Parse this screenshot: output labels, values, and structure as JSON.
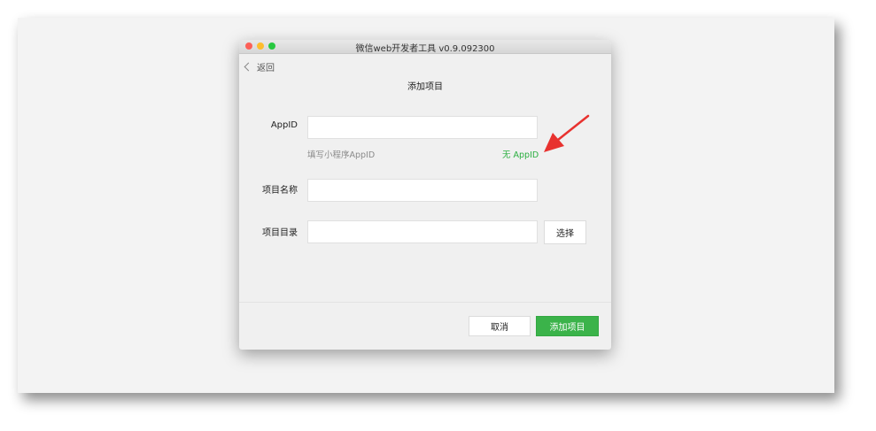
{
  "window": {
    "title": "微信web开发者工具 v0.9.092300"
  },
  "nav": {
    "back_label": "返回"
  },
  "dialog": {
    "title": "添加项目"
  },
  "form": {
    "appid": {
      "label": "AppID",
      "value": "",
      "placeholder": "",
      "hint": "填写小程序AppID",
      "no_appid_link": "无 AppID"
    },
    "project_name": {
      "label": "项目名称",
      "value": "",
      "placeholder": ""
    },
    "project_dir": {
      "label": "项目目录",
      "value": "",
      "placeholder": "",
      "choose_label": "选择"
    }
  },
  "footer": {
    "cancel_label": "取消",
    "add_label": "添加项目"
  },
  "colors": {
    "primary_green": "#3bb34a",
    "link_green": "#2aae3f",
    "annotation_arrow": "#e8322f"
  },
  "icons": {
    "back": "chevron-left-icon",
    "annotation": "red-arrow-icon"
  }
}
